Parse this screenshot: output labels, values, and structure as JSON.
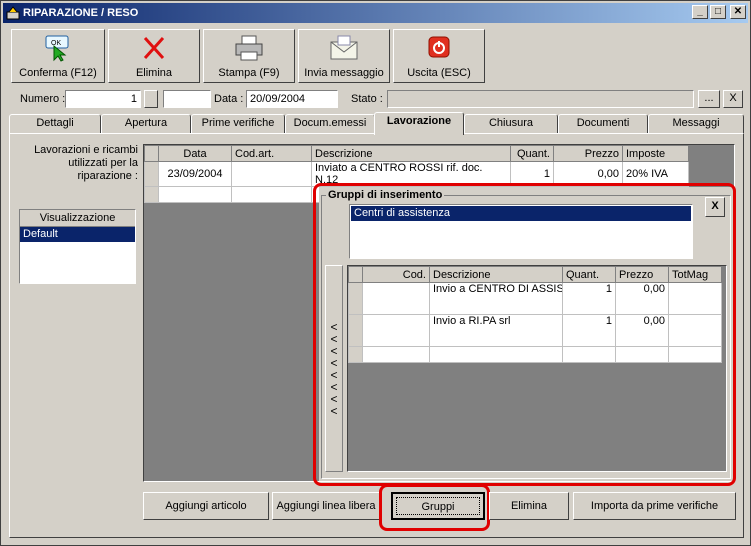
{
  "window": {
    "title": "RIPARAZIONE / RESO",
    "minimize": "_",
    "maximize": "□",
    "close": "✕"
  },
  "toolbar": {
    "confirm": "Conferma (F12)",
    "confirm_badge": "OK",
    "delete": "Elimina",
    "print": "Stampa (F9)",
    "send": "Invia messaggio",
    "exit": "Uscita (ESC)"
  },
  "header": {
    "numero_label": "Numero :",
    "numero_value": "1",
    "data_label": "Data :",
    "data_value": "20/09/2004",
    "stato_label": "Stato :",
    "stato_value": "",
    "dots_button": "...",
    "clear_button": "X"
  },
  "tabs": [
    "Dettagli",
    "Apertura",
    "Prime verifiche",
    "Docum.emessi",
    "Lavorazione",
    "Chiusura",
    "Documenti",
    "Messaggi"
  ],
  "left": {
    "caption": "Lavorazioni e ricambi utilizzati per la riparazione :",
    "list_header": "Visualizzazione",
    "list_items": [
      "Default"
    ]
  },
  "main_grid": {
    "columns": [
      "Data",
      "Cod.art.",
      "Descrizione",
      "Quant.",
      "Prezzo",
      "Imposte"
    ],
    "rows": [
      [
        "23/09/2004",
        "",
        "Inviato a CENTRO ROSSI rif. doc. N.12",
        "1",
        "0,00",
        "20% IVA"
      ]
    ]
  },
  "groups": {
    "title": "Gruppi di inserimento",
    "close": "X",
    "list_items": [
      "Centri di assistenza"
    ],
    "columns": [
      "Cod.",
      "Descrizione",
      "Quant.",
      "Prezzo",
      "TotMag"
    ],
    "rows": [
      [
        "",
        "Invio a CENTRO DI ASSIS",
        "1",
        "0,00",
        ""
      ],
      [
        "",
        "Invio a RI.PA srl",
        "1",
        "0,00",
        ""
      ]
    ],
    "arrows": [
      "<",
      "<",
      "<",
      "<",
      "<",
      "<",
      "<",
      "<"
    ]
  },
  "bottom": {
    "add_article": "Aggiungi articolo",
    "add_free_line": "Aggiungi linea libera",
    "groups": "Gruppi",
    "delete": "Elimina",
    "import": "Importa da prime verifiche"
  },
  "colors": {
    "highlight": "#e00000",
    "selection": "#0a246a",
    "title_gradient_start": "#0a246a"
  }
}
